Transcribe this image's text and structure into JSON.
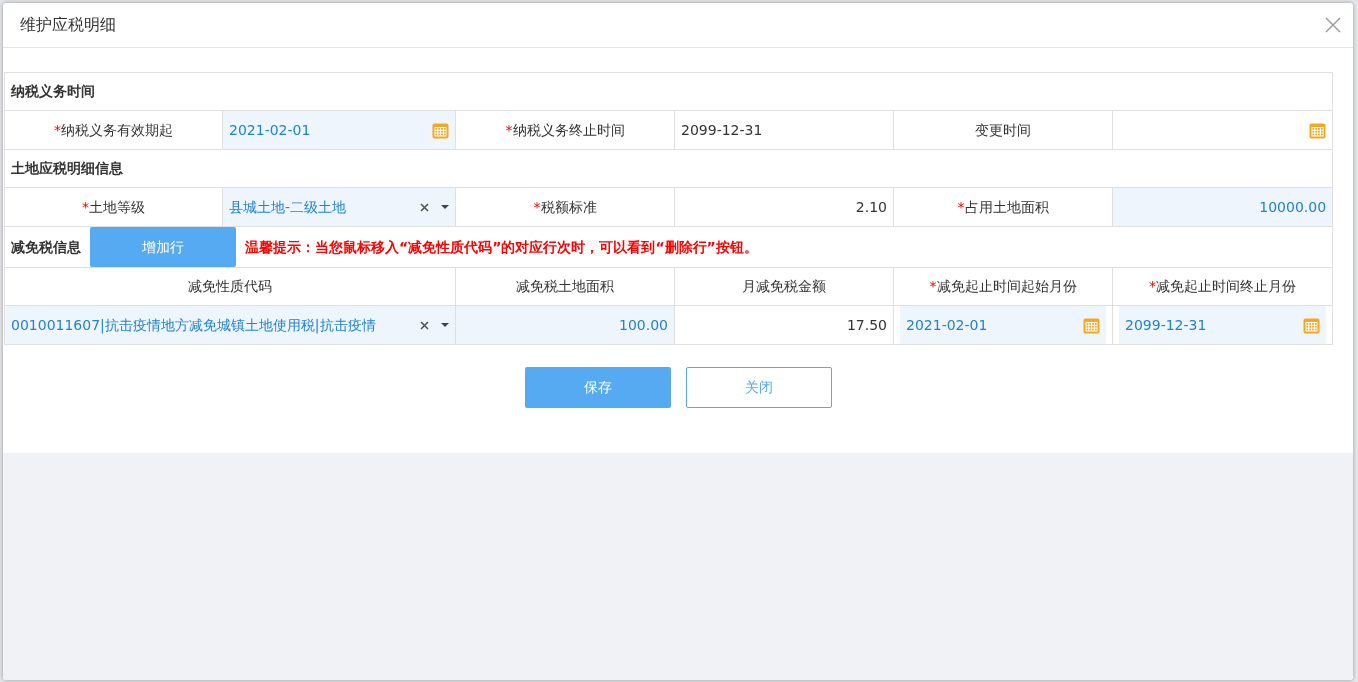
{
  "dialog": {
    "title": "维护应税明细"
  },
  "sections": [
    {
      "title": "纳税义务时间",
      "fields": [
        {
          "mark": "*",
          "label": "纳税义务有效期起",
          "kind": "date",
          "value": "2021-02-01",
          "editable": true
        },
        {
          "mark": "*",
          "label": "纳税义务终止时间",
          "kind": "text",
          "value": "2099-12-31",
          "editable": false
        },
        {
          "label": "变更时间",
          "kind": "date",
          "editable": false
        }
      ]
    },
    {
      "title": "土地应税明细信息",
      "fields": [
        {
          "mark": "*",
          "label": "土地等级",
          "kind": "select",
          "value": "县城土地-二级土地",
          "editable": true
        },
        {
          "mark": "*",
          "label": "税额标准",
          "kind": "number",
          "value": "2.10",
          "editable": false
        },
        {
          "mark": "*",
          "label": "占用土地面积",
          "kind": "number",
          "value": "10000.00",
          "editable": true
        }
      ]
    }
  ],
  "relief": {
    "title": "减免税信息",
    "add_button": "增加行",
    "tip": "温馨提示：当您鼠标移入“减免性质代码”的对应行次时，可以看到“删除行”按钮。",
    "columns": [
      {
        "label": "减免性质代码"
      },
      {
        "label": "减免税土地面积"
      },
      {
        "label": "月减免税金额"
      },
      {
        "mark": "*",
        "label": "减免起止时间起始月份"
      },
      {
        "mark": "*",
        "label": "减免起止时间终止月份"
      }
    ],
    "rows": [
      {
        "cells": [
          {
            "kind": "select",
            "value": "0010011607|抗击疫情地方减免城镇土地使用税|抗击疫情",
            "editable": true
          },
          {
            "kind": "number",
            "value": "100.00",
            "editable": true
          },
          {
            "kind": "number",
            "value": "17.50",
            "editable": false
          },
          {
            "kind": "date",
            "value": "2021-02-01",
            "editable": true
          },
          {
            "kind": "date",
            "value": "2099-12-31",
            "editable": true
          }
        ]
      }
    ]
  },
  "buttons": [
    {
      "label": "保存",
      "kind": "primary"
    },
    {
      "label": "关闭",
      "kind": "outline"
    }
  ]
}
